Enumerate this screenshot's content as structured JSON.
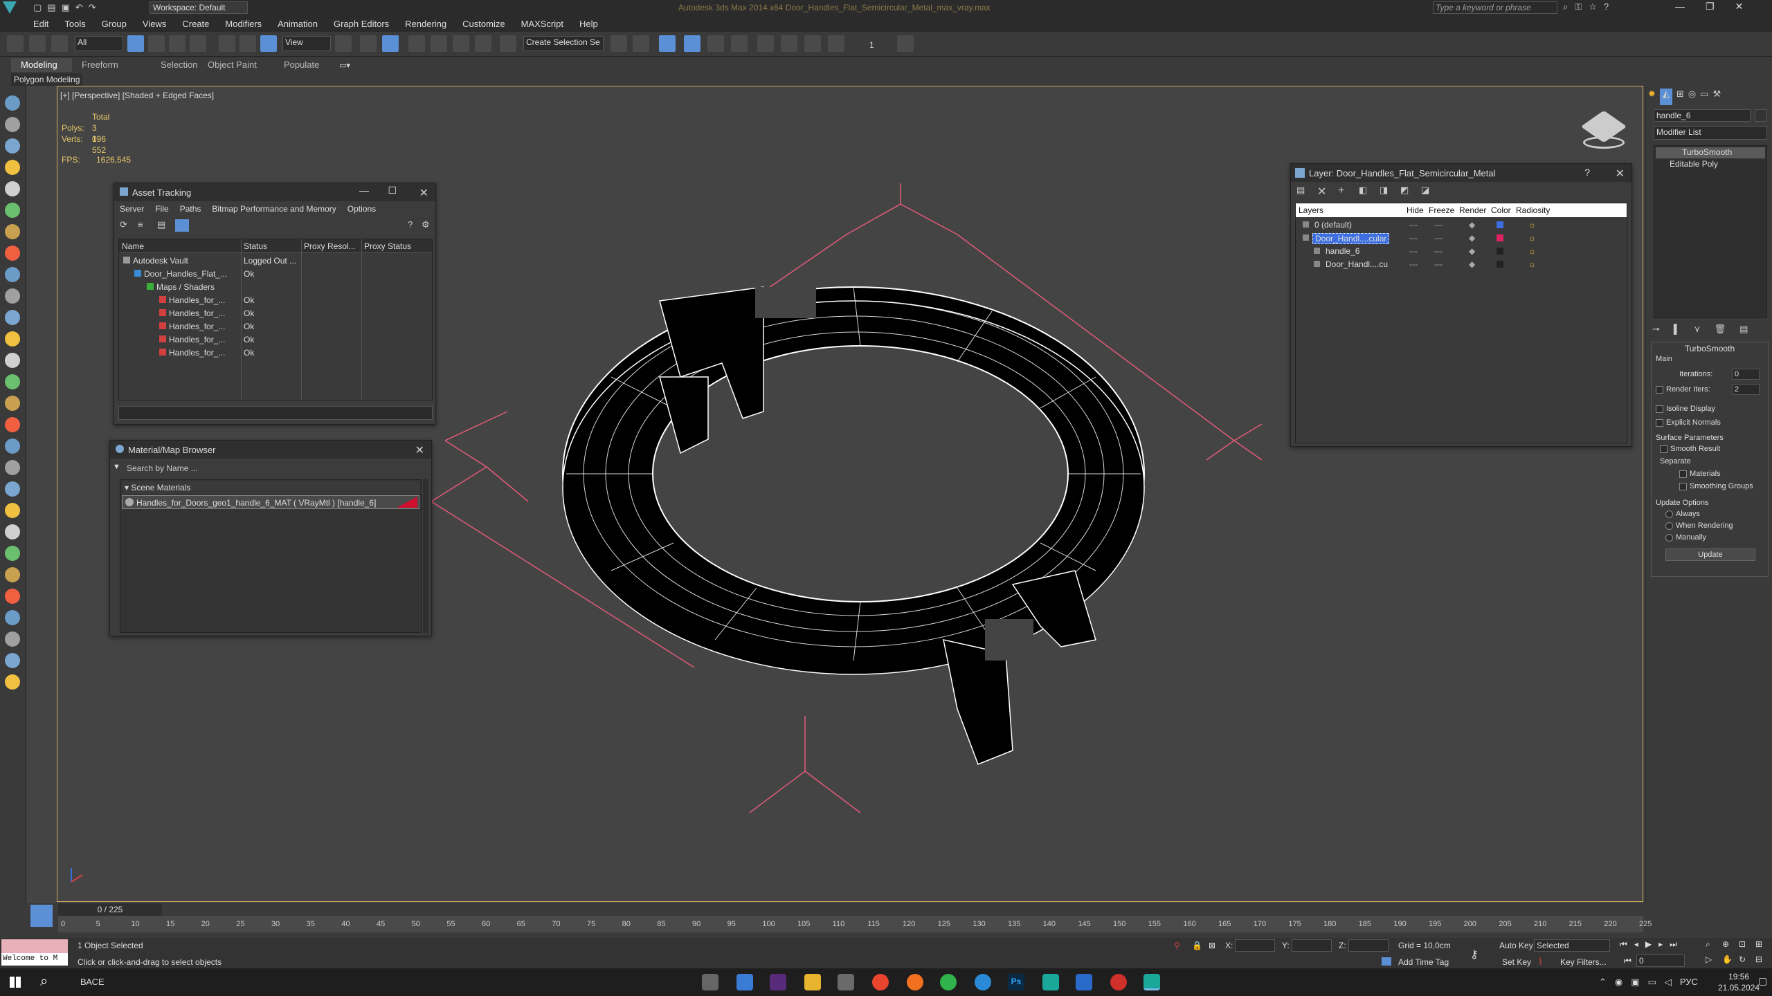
{
  "app": {
    "title": "Autodesk 3ds Max 2014 x64    Door_Handles_Flat_Semicircular_Metal_max_vray.max",
    "workspace": "Workspace: Default",
    "search_placeholder": "Type a keyword or phrase"
  },
  "menu": [
    "Edit",
    "Tools",
    "Group",
    "Views",
    "Create",
    "Modifiers",
    "Animation",
    "Graph Editors",
    "Rendering",
    "Customize",
    "MAXScript",
    "Help"
  ],
  "toolbar": {
    "selection_filter": "All",
    "ref_coord": "View",
    "named_selection": "Create Selection Se",
    "spinner_value": "1"
  },
  "ribbon": {
    "tabs": [
      "Modeling",
      "Freeform",
      "Selection",
      "Object Paint",
      "Populate"
    ],
    "subtitle": "Polygon Modeling"
  },
  "viewport": {
    "label": "[+] [Perspective] [Shaded + Edged Faces]",
    "stats": {
      "total_label": "Total",
      "polys_label": "Polys:",
      "polys_value": "3 096",
      "verts_label": "Verts:",
      "verts_value": "1 552",
      "fps_label": "FPS:",
      "fps_value": "1626,545"
    }
  },
  "asset_tracking": {
    "title": "Asset Tracking",
    "menu": [
      "Server",
      "File",
      "Paths",
      "Bitmap Performance and Memory",
      "Options"
    ],
    "columns": [
      "Name",
      "Status",
      "Proxy Resol...",
      "Proxy Status"
    ],
    "rows": [
      {
        "name": "Autodesk Vault",
        "status": "Logged Out ..."
      },
      {
        "name": "Door_Handles_Flat_...",
        "status": "Ok"
      },
      {
        "name": "Maps / Shaders",
        "status": ""
      },
      {
        "name": "Handles_for_...",
        "status": "Ok"
      },
      {
        "name": "Handles_for_...",
        "status": "Ok"
      },
      {
        "name": "Handles_for_...",
        "status": "Ok"
      },
      {
        "name": "Handles_for_...",
        "status": "Ok"
      },
      {
        "name": "Handles_for_...",
        "status": "Ok"
      }
    ]
  },
  "material_browser": {
    "title": "Material/Map Browser",
    "search_placeholder": "Search by Name ...",
    "group": "Scene Materials",
    "item": "Handles_for_Doors_geo1_handle_6_MAT ( VRayMtl ) [handle_6]"
  },
  "layer_dialog": {
    "title": "Layer: Door_Handles_Flat_Semicircular_Metal",
    "help": "?",
    "columns": [
      "Layers",
      "Hide",
      "Freeze",
      "Render",
      "Color",
      "Radiosity"
    ],
    "rows": [
      {
        "name": "0 (default)",
        "color": "#3d6fe0"
      },
      {
        "name": "Door_Handl....cular",
        "color": "#e02060"
      },
      {
        "name": "handle_6",
        "color": "#222222"
      },
      {
        "name": "Door_Handl....cu",
        "color": "#222222"
      }
    ]
  },
  "command_panel": {
    "object_name": "handle_6",
    "modifier_list": "Modifier List",
    "stack": [
      "TurboSmooth",
      "Editable Poly"
    ],
    "rollout_title": "TurboSmooth",
    "main_label": "Main",
    "iterations_label": "Iterations:",
    "iterations_value": "0",
    "render_iters_label": "Render Iters:",
    "render_iters_value": "2",
    "isoline": "Isoline Display",
    "explicit_normals": "Explicit Normals",
    "surface_params": "Surface Parameters",
    "smooth_result": "Smooth Result",
    "separate": "Separate",
    "materials": "Materials",
    "smoothing_groups": "Smoothing Groups",
    "update_options": "Update Options",
    "always": "Always",
    "when_rendering": "When Rendering",
    "manually": "Manually",
    "update_button": "Update"
  },
  "timeline": {
    "frame": "0 / 225",
    "ticks": [
      "0",
      "5",
      "10",
      "15",
      "20",
      "25",
      "30",
      "35",
      "40",
      "45",
      "50",
      "55",
      "60",
      "65",
      "70",
      "75",
      "80",
      "85",
      "90",
      "95",
      "100",
      "105",
      "110",
      "115",
      "120",
      "125",
      "130",
      "135",
      "140",
      "145",
      "150",
      "155",
      "160",
      "165",
      "170",
      "175",
      "180",
      "185",
      "190",
      "195",
      "200",
      "205",
      "210",
      "215",
      "220",
      "225"
    ]
  },
  "status": {
    "selected": "1 Object Selected",
    "prompt": "Click or click-and-drag to select objects",
    "welcome": "Welcome to M",
    "x_label": "X:",
    "y_label": "Y:",
    "z_label": "Z:",
    "grid": "Grid = 10,0cm",
    "auto_key": "Auto Key",
    "selected_dropdown": "Selected",
    "set_key": "Set Key",
    "key_filters": "Key Filters...",
    "add_time_tag": "Add Time Tag",
    "frame_field": "0"
  },
  "taskbar": {
    "search": "ВАСЕ",
    "lang": "РУС",
    "time": "19:56",
    "date": "21.05.2024"
  },
  "colors": {
    "accent": "#5b8fd6",
    "viewport_border": "#d6b25a",
    "bbox_lines": "#e25b78",
    "material_swatch": "#d01030"
  }
}
